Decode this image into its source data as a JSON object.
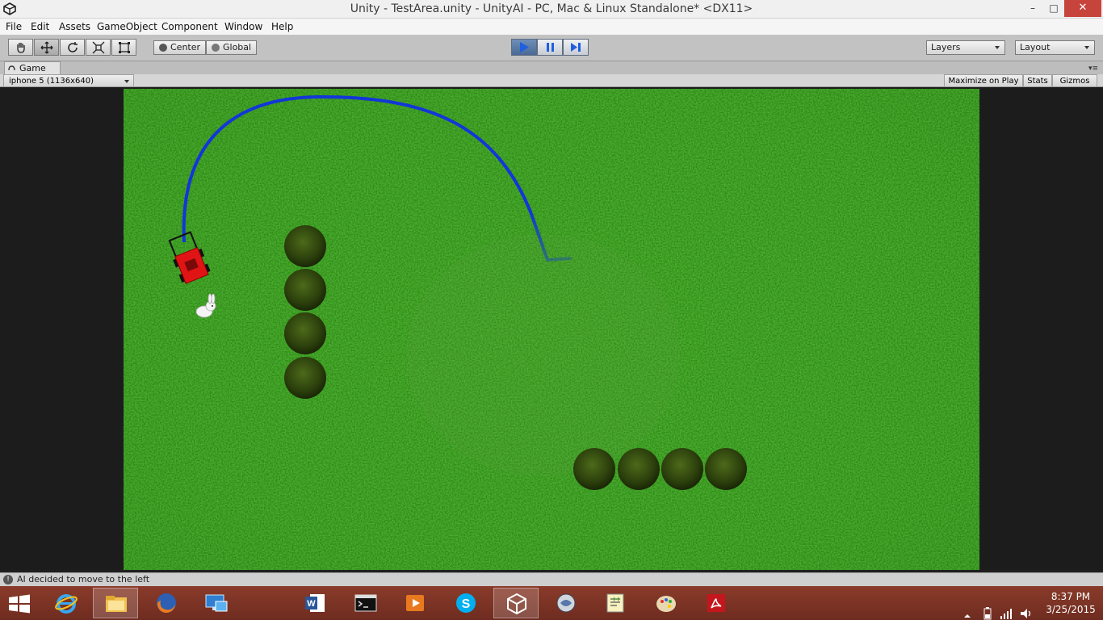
{
  "window": {
    "title": "Unity - TestArea.unity - UnityAI - PC, Mac & Linux Standalone* <DX11>",
    "controls": {
      "minimize": "–",
      "maximize": "□",
      "close": "✕"
    }
  },
  "menu": [
    "File",
    "Edit",
    "Assets",
    "GameObject",
    "Component",
    "Window",
    "Help"
  ],
  "toolbar": {
    "tools": [
      "hand-icon",
      "move-icon",
      "rotate-icon",
      "scale-icon",
      "rect-icon"
    ],
    "active_tool": "move-icon",
    "pivot_mode": "Center",
    "pivot_rotation": "Global",
    "playback": {
      "play_active": true,
      "pause_active": false,
      "step_active": false
    },
    "layers": "Layers",
    "layout": "Layout"
  },
  "game_tab": {
    "label": "Game",
    "aspect": "iphone 5 (1136x640)",
    "maximize_on_play": "Maximize on Play",
    "stats": "Stats",
    "gizmos": "Gizmos"
  },
  "scene": {
    "background": "grass",
    "path_color": "#1236d8",
    "mower_color": "#e01414",
    "objects": [
      "lawn-mower",
      "rabbit",
      "bush",
      "bush",
      "bush",
      "bush",
      "bush",
      "bush",
      "bush",
      "bush"
    ]
  },
  "console": {
    "last_message": "AI decided to move to the left"
  },
  "taskbar": {
    "apps": [
      "internet-explorer",
      "file-explorer",
      "firefox",
      "remote-desktop",
      "word",
      "command-prompt",
      "media-player",
      "skype",
      "unity",
      "network-monitor",
      "notepad-plus",
      "paint",
      "acrobat"
    ],
    "active_app": "unity",
    "clock_time": "8:37 PM",
    "clock_date": "3/25/2015"
  }
}
